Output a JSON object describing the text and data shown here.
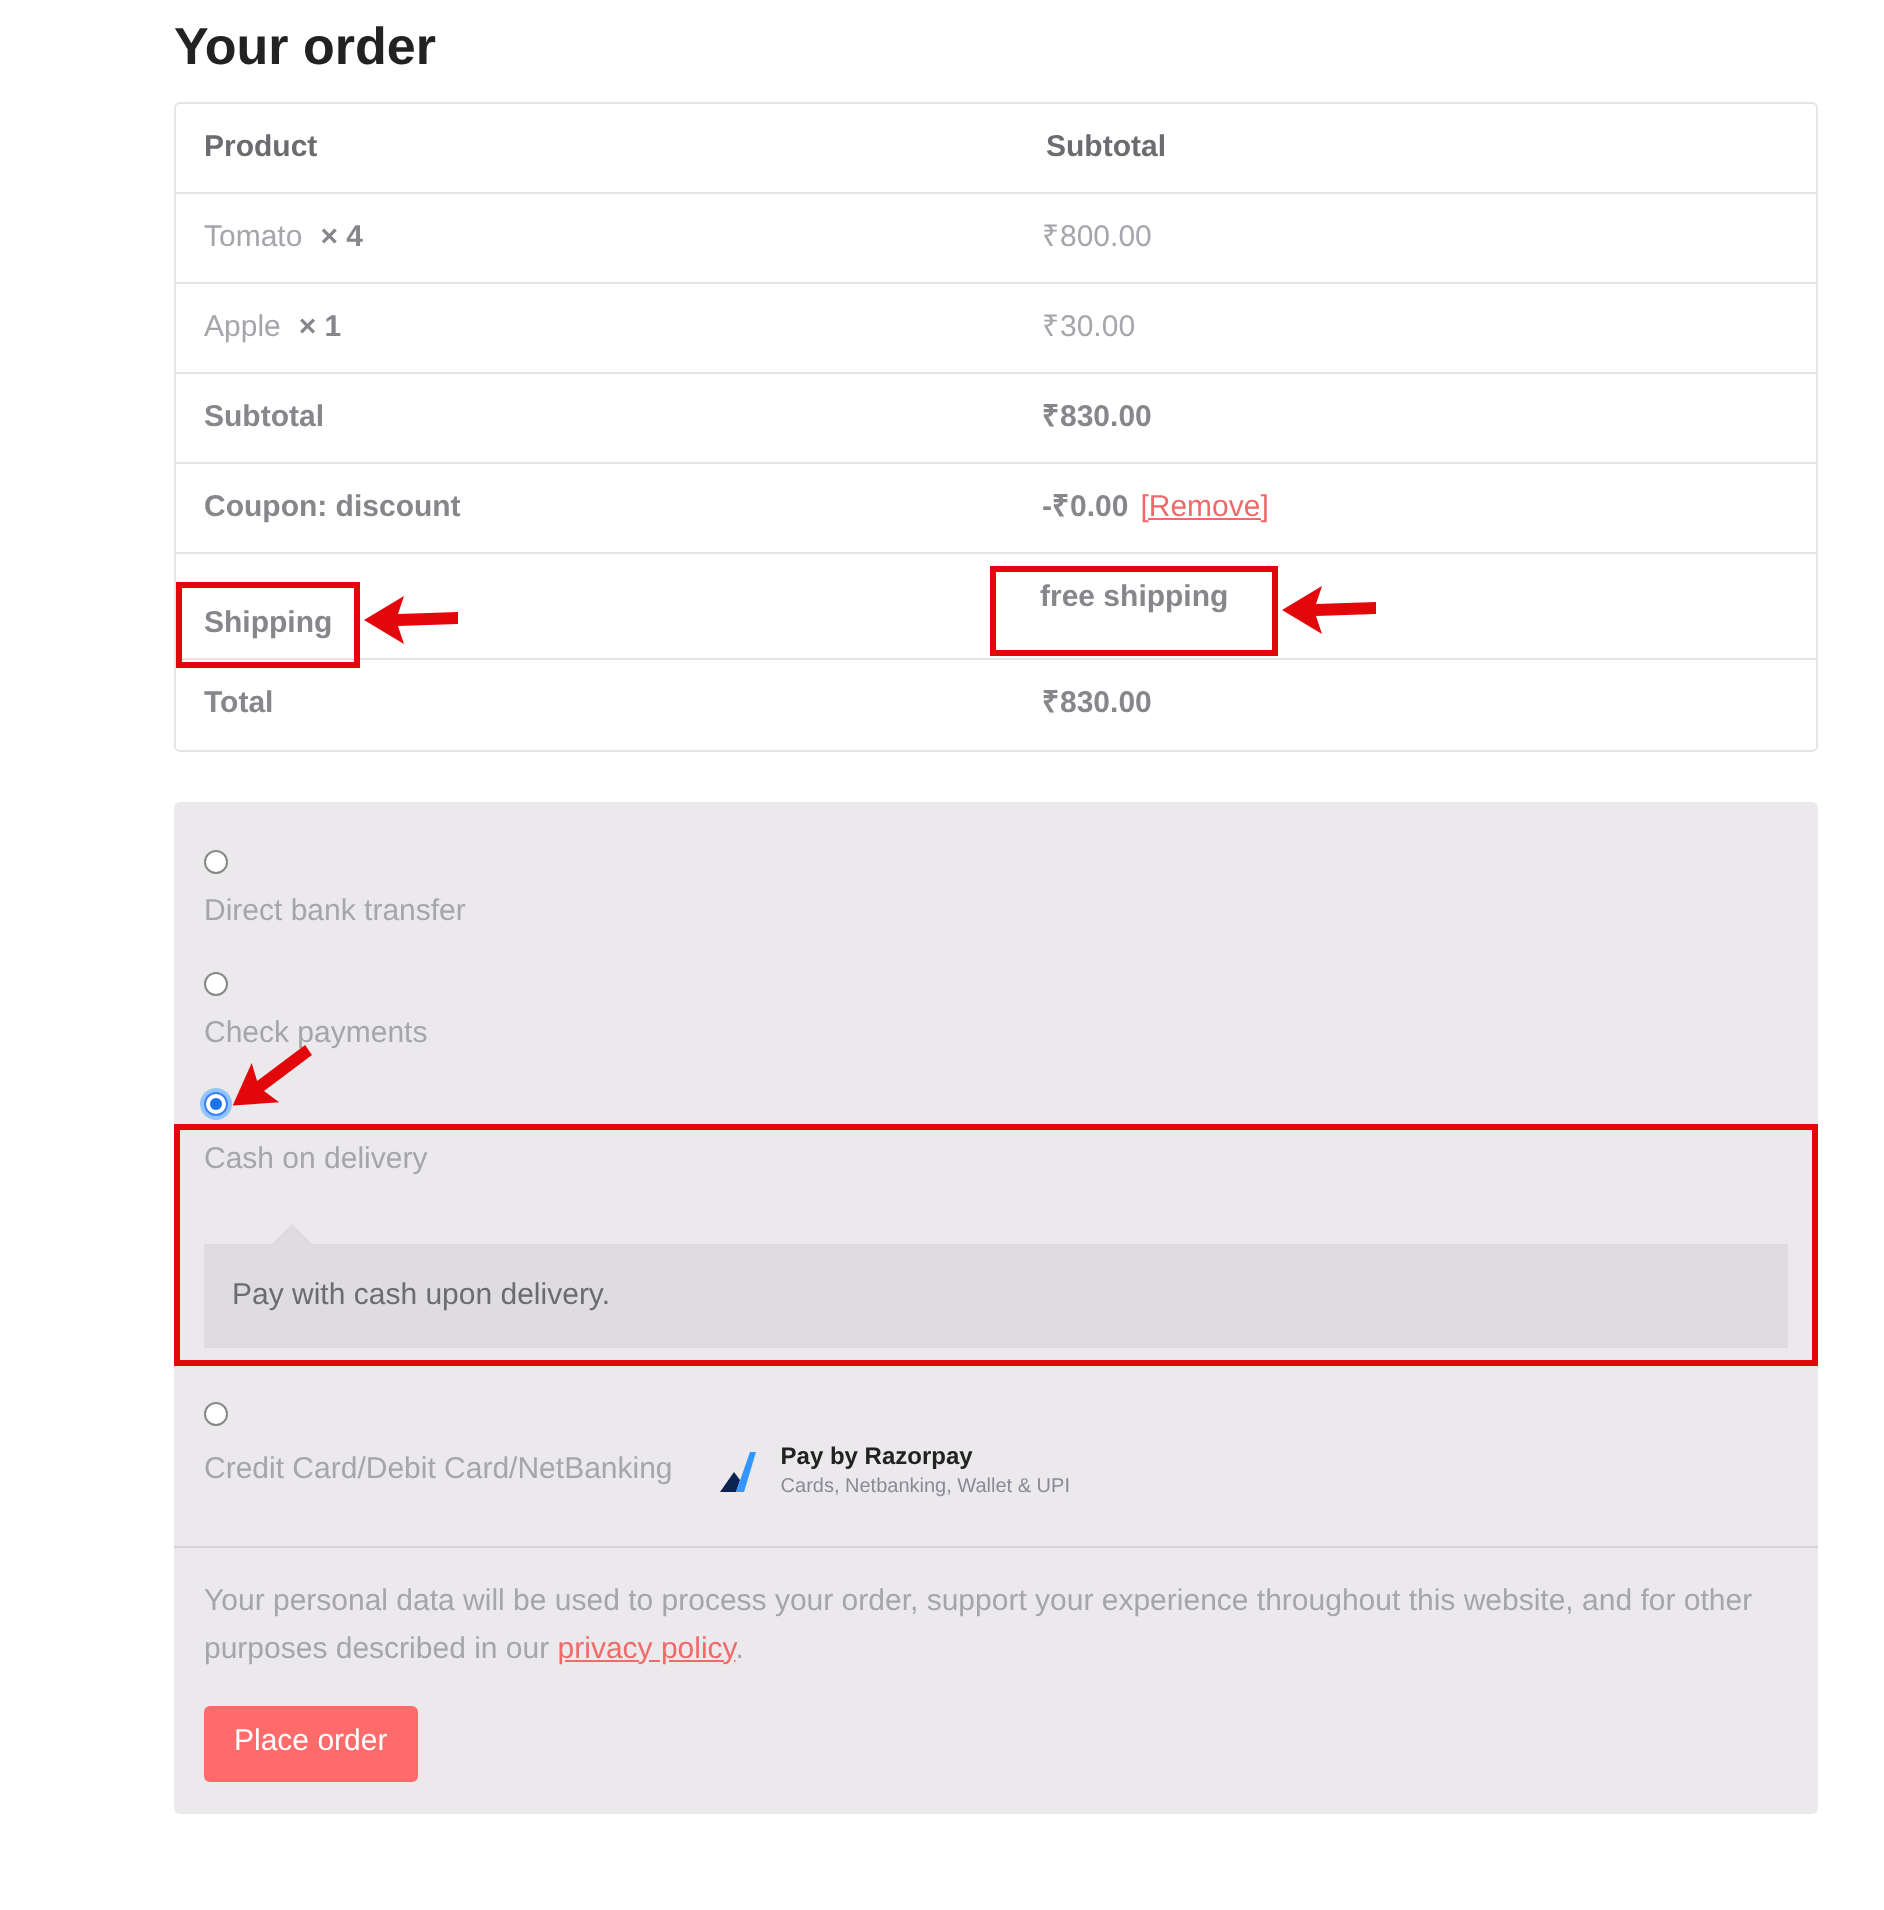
{
  "heading": "Your order",
  "table": {
    "columns": [
      "Product",
      "Subtotal"
    ],
    "rows": [
      {
        "kind": "item",
        "name": "Tomato",
        "quantity": "× 4",
        "value": "₹800.00",
        "highlighted": false
      },
      {
        "kind": "item",
        "name": "Apple",
        "quantity": "× 1",
        "value": "₹30.00",
        "highlighted": false
      },
      {
        "kind": "total",
        "label": "Subtotal",
        "value": "₹830.00",
        "highlighted": false
      },
      {
        "kind": "coupon",
        "label": "Coupon: discount",
        "value": "-₹0.00",
        "link": "[Remove]",
        "highlighted": false
      },
      {
        "kind": "total",
        "label": "Shipping",
        "value": "free shipping",
        "highlighted": true
      },
      {
        "kind": "total",
        "label": "Total",
        "value": "₹830.00",
        "highlighted": false
      }
    ]
  },
  "payment_methods": [
    {
      "label": "Direct bank transfer",
      "selected": false,
      "highlighted": false
    },
    {
      "label": "Check payments",
      "selected": false,
      "highlighted": false
    },
    {
      "label": "Cash on delivery",
      "selected": true,
      "highlighted": true,
      "description": "Pay with cash upon delivery."
    },
    {
      "label": "Credit Card/Debit Card/NetBanking",
      "selected": false,
      "highlighted": false,
      "badge": {
        "title": "Pay by Razorpay",
        "subtitle": "Cards, Netbanking, Wallet & UPI"
      }
    }
  ],
  "privacy": {
    "text": "Your personal data will be used to process your order, support your experience throughout this website, and for other purposes described in our",
    "link": "privacy policy",
    "end": "."
  },
  "button": "Place order"
}
